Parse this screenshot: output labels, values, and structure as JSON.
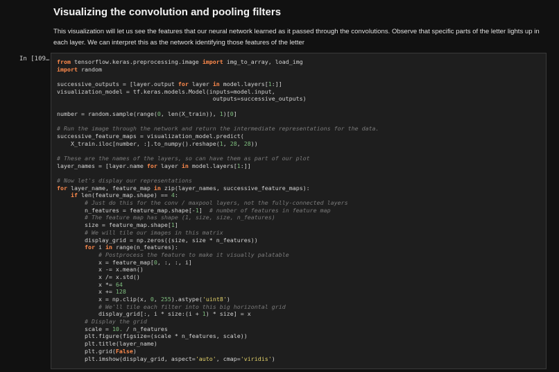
{
  "markdown": {
    "heading": "Visualizing the convolution and pooling filters",
    "paragraph": "This visualization will let us see the features that our neural network learned as it passed through the convolutions. Observe that specific parts of the letter lights up in each layer. We can interpret this as the network identifying those features of the letter"
  },
  "cell": {
    "prompt": "In [109…",
    "lines": [
      [
        {
          "t": "from",
          "c": "kw"
        },
        {
          "t": " tensorflow.keras.preprocessing.image "
        },
        {
          "t": "import",
          "c": "kw"
        },
        {
          "t": " img_to_array, load_img"
        }
      ],
      [
        {
          "t": "import",
          "c": "kw"
        },
        {
          "t": " random"
        }
      ],
      [],
      [
        {
          "t": "successive_outputs = [layer.output "
        },
        {
          "t": "for",
          "c": "kw"
        },
        {
          "t": " layer "
        },
        {
          "t": "in",
          "c": "kw"
        },
        {
          "t": " model.layers["
        },
        {
          "t": "1",
          "c": "num"
        },
        {
          "t": ":]]"
        }
      ],
      [
        {
          "t": "visualization_model = tf.keras.models.Model(inputs=model.input,"
        }
      ],
      [
        {
          "t": "                                             outputs=successive_outputs)"
        }
      ],
      [],
      [
        {
          "t": "number = random.sample(range("
        },
        {
          "t": "0",
          "c": "num"
        },
        {
          "t": ", len(X_train)), "
        },
        {
          "t": "1",
          "c": "num"
        },
        {
          "t": ")["
        },
        {
          "t": "0",
          "c": "num"
        },
        {
          "t": "]"
        }
      ],
      [],
      [
        {
          "t": "# Run the image through the network and return the intermediate representations for the data.",
          "c": "cm"
        }
      ],
      [
        {
          "t": "successive_feature_maps = visualization_model.predict("
        }
      ],
      [
        {
          "t": "    X_train.iloc[number, :].to_numpy().reshape("
        },
        {
          "t": "1",
          "c": "num"
        },
        {
          "t": ", "
        },
        {
          "t": "28",
          "c": "num"
        },
        {
          "t": ", "
        },
        {
          "t": "28",
          "c": "num"
        },
        {
          "t": "))"
        }
      ],
      [],
      [
        {
          "t": "# These are the names of the layers, so can have them as part of our plot",
          "c": "cm"
        }
      ],
      [
        {
          "t": "layer_names = [layer.name "
        },
        {
          "t": "for",
          "c": "kw"
        },
        {
          "t": " layer "
        },
        {
          "t": "in",
          "c": "kw"
        },
        {
          "t": " model.layers["
        },
        {
          "t": "1",
          "c": "num"
        },
        {
          "t": ":]]"
        }
      ],
      [],
      [
        {
          "t": "# Now let's display our representations",
          "c": "cm"
        }
      ],
      [
        {
          "t": "for",
          "c": "kw"
        },
        {
          "t": " layer_name, feature_map "
        },
        {
          "t": "in",
          "c": "kw"
        },
        {
          "t": " zip(layer_names, successive_feature_maps):"
        }
      ],
      [
        {
          "t": "    "
        },
        {
          "t": "if",
          "c": "kw"
        },
        {
          "t": " len(feature_map.shape) == "
        },
        {
          "t": "4",
          "c": "num"
        },
        {
          "t": ":"
        }
      ],
      [
        {
          "t": "        "
        },
        {
          "t": "# Just do this for the conv / maxpool layers, not the fully-connected layers",
          "c": "cm"
        }
      ],
      [
        {
          "t": "        n_features = feature_map.shape[-"
        },
        {
          "t": "1",
          "c": "num"
        },
        {
          "t": "]  "
        },
        {
          "t": "# number of features in feature map",
          "c": "cm"
        }
      ],
      [
        {
          "t": "        "
        },
        {
          "t": "# The feature map has shape (1, size, size, n_features)",
          "c": "cm"
        }
      ],
      [
        {
          "t": "        size = feature_map.shape["
        },
        {
          "t": "1",
          "c": "num"
        },
        {
          "t": "]"
        }
      ],
      [
        {
          "t": "        "
        },
        {
          "t": "# We will tile our images in this matrix",
          "c": "cm"
        }
      ],
      [
        {
          "t": "        display_grid = np.zeros((size, size * n_features))"
        }
      ],
      [
        {
          "t": "        "
        },
        {
          "t": "for",
          "c": "kw"
        },
        {
          "t": " i "
        },
        {
          "t": "in",
          "c": "kw"
        },
        {
          "t": " range(n_features):"
        }
      ],
      [
        {
          "t": "            "
        },
        {
          "t": "# Postprocess the feature to make it visually palatable",
          "c": "cm"
        }
      ],
      [
        {
          "t": "            x = feature_map["
        },
        {
          "t": "0",
          "c": "num"
        },
        {
          "t": ", :, :, i]"
        }
      ],
      [
        {
          "t": "            x -= x.mean()"
        }
      ],
      [
        {
          "t": "            x /= x.std()"
        }
      ],
      [
        {
          "t": "            x *= "
        },
        {
          "t": "64",
          "c": "num"
        }
      ],
      [
        {
          "t": "            x += "
        },
        {
          "t": "128",
          "c": "num"
        }
      ],
      [
        {
          "t": "            x = np.clip(x, "
        },
        {
          "t": "0",
          "c": "num"
        },
        {
          "t": ", "
        },
        {
          "t": "255",
          "c": "num"
        },
        {
          "t": ").astype("
        },
        {
          "t": "'uint8'",
          "c": "str"
        },
        {
          "t": ")"
        }
      ],
      [
        {
          "t": "            "
        },
        {
          "t": "# We'll tile each filter into this big horizontal grid",
          "c": "cm"
        }
      ],
      [
        {
          "t": "            display_grid[:, i * size:(i + "
        },
        {
          "t": "1",
          "c": "num"
        },
        {
          "t": ") * size] = x"
        }
      ],
      [
        {
          "t": "        "
        },
        {
          "t": "# Display the grid",
          "c": "cm"
        }
      ],
      [
        {
          "t": "        scale = "
        },
        {
          "t": "10.",
          "c": "num"
        },
        {
          "t": " / n_features"
        }
      ],
      [
        {
          "t": "        plt.figure(figsize=(scale * n_features, scale))"
        }
      ],
      [
        {
          "t": "        plt.title(layer_name)"
        }
      ],
      [
        {
          "t": "        plt.grid("
        },
        {
          "t": "False",
          "c": "kw"
        },
        {
          "t": ")"
        }
      ],
      [
        {
          "t": "        plt.imshow(display_grid, aspect="
        },
        {
          "t": "'auto'",
          "c": "str"
        },
        {
          "t": ", cmap="
        },
        {
          "t": "'viridis'",
          "c": "str"
        },
        {
          "t": ")"
        }
      ]
    ]
  }
}
